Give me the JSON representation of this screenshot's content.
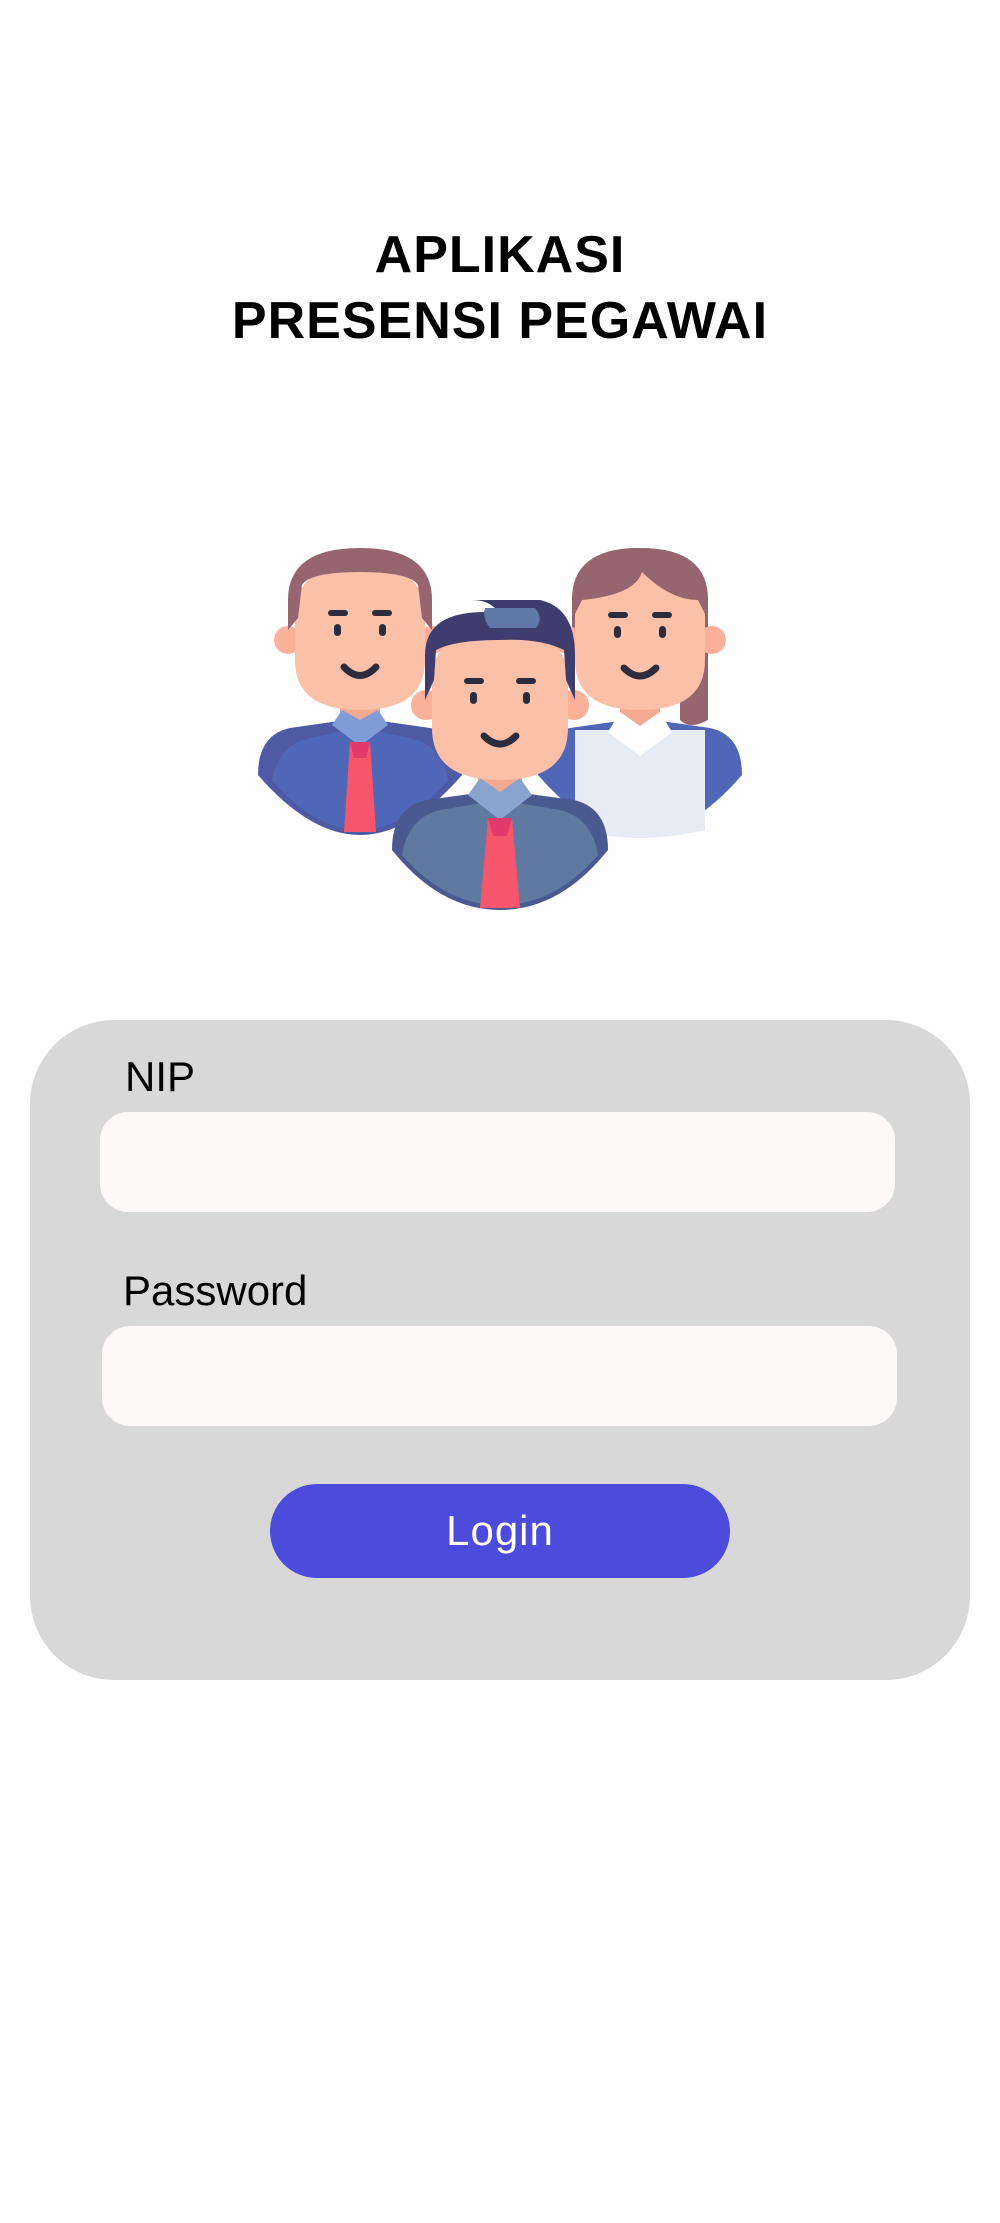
{
  "header": {
    "title_line1": "APLIKASI",
    "title_line2": "PRESENSI PEGAWAI"
  },
  "illustration": {
    "icon": "employees-group-icon",
    "colors": {
      "hair": "#976570",
      "hair_dark": "#3f3d6e",
      "skin": "#fbc0a8",
      "suit": "#5066b6",
      "suit_front": "#5f79a0",
      "tie": "#f6566d",
      "collar": "#7f9bd8",
      "blouse": "#e7ecf4"
    }
  },
  "form": {
    "nip_label": "NIP",
    "nip_value": "",
    "password_label": "Password",
    "password_value": "",
    "login_label": "Login"
  },
  "colors": {
    "card_bg": "#d8d8d8",
    "input_bg": "#fdf9f9",
    "button_bg": "#4c4bdc",
    "button_text": "#ffffff"
  }
}
